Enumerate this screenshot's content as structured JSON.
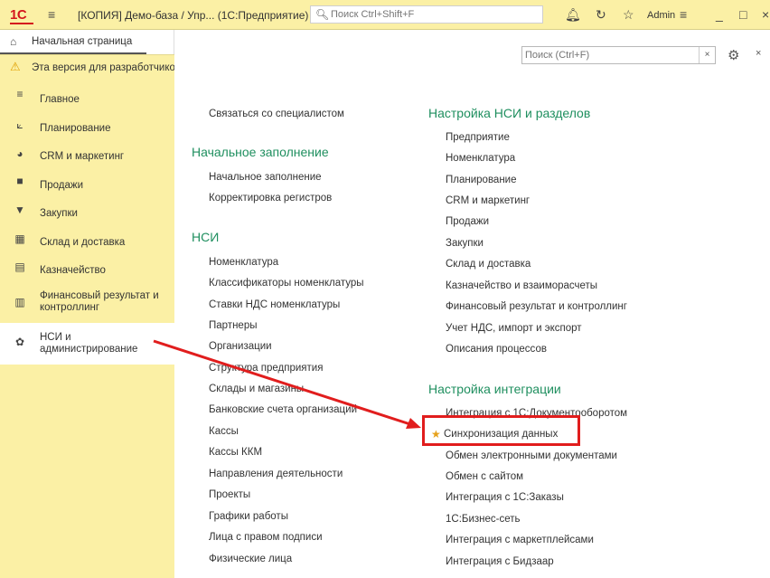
{
  "titlebar": {
    "logo": "1С",
    "title": "[КОПИЯ] Демо-база / Упр... (1С:Предприятие)",
    "search_placeholder": "Поиск Ctrl+Shift+F",
    "user": "Admin"
  },
  "home_tab": {
    "label": "Начальная страница"
  },
  "banner": {
    "text": "Эта версия для разработчиков"
  },
  "sidebar": {
    "items": [
      {
        "label": "Главное",
        "icon": "menu-icon"
      },
      {
        "label": "Планирование",
        "icon": "chart-icon"
      },
      {
        "label": "CRM и маркетинг",
        "icon": "pie-icon"
      },
      {
        "label": "Продажи",
        "icon": "bag-icon"
      },
      {
        "label": "Закупки",
        "icon": "cart-icon"
      },
      {
        "label": "Склад и доставка",
        "icon": "warehouse-icon"
      },
      {
        "label": "Казначейство",
        "icon": "coins-icon"
      },
      {
        "label": "Финансовый результат и контроллинг",
        "icon": "bar-chart-icon"
      },
      {
        "label": "НСИ и администрирование",
        "icon": "gear-icon"
      }
    ]
  },
  "panel": {
    "search_placeholder": "Поиск (Ctrl+F)",
    "clear": "×",
    "close": "×"
  },
  "left_col": {
    "top_link": "Связаться со специалистом",
    "initial_title": "Начальное заполнение",
    "initial_links": [
      "Начальное заполнение",
      "Корректировка регистров"
    ],
    "nsi_title": "НСИ",
    "nsi_links": [
      "Номенклатура",
      "Классификаторы номенклатуры",
      "Ставки НДС номенклатуры",
      "Партнеры",
      "Организации",
      "Структура предприятия",
      "Склады и магазины",
      "Банковские счета организаций",
      "Кассы",
      "Кассы ККМ",
      "Направления деятельности",
      "Проекты",
      "Графики работы",
      "Лица с правом подписи",
      "Физические лица"
    ]
  },
  "right_col": {
    "settings_title": "Настройка НСИ и разделов",
    "settings_links": [
      "Предприятие",
      "Номенклатура",
      "Планирование",
      "CRM и маркетинг",
      "Продажи",
      "Закупки",
      "Склад и доставка",
      "Казначейство и взаиморасчеты",
      "Финансовый результат и контроллинг",
      "Учет НДС, импорт и экспорт",
      "Описания процессов"
    ],
    "integration_title": "Настройка интеграции",
    "integration_links": [
      "Интеграция с 1С:Документооборотом",
      "Синхронизация данных",
      "Обмен электронными документами",
      "Обмен с сайтом",
      "Интеграция с 1С:Заказы",
      "1С:Бизнес-сеть",
      "Интеграция с маркетплейсами",
      "Интеграция с Бидзаар"
    ]
  },
  "colors": {
    "accent_green": "#1f8f5f",
    "highlight_red": "#e11d1d",
    "bar_yellow": "#fbf0a5"
  }
}
